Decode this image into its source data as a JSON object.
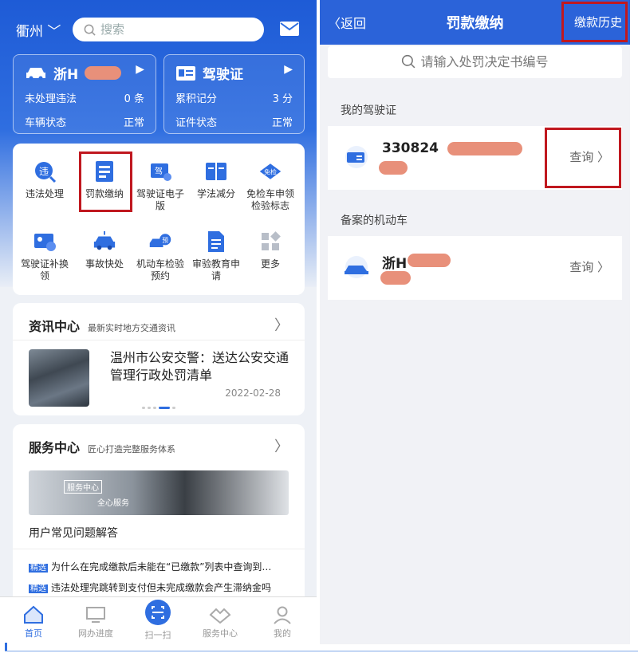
{
  "left": {
    "city": "衢州",
    "search_placeholder": "搜索",
    "vehicle_card": {
      "plate": "浙H",
      "rows": [
        {
          "label": "未处理违法",
          "value": "0",
          "unit": "条"
        },
        {
          "label": "车辆状态",
          "value": "正常"
        }
      ]
    },
    "license_card": {
      "title": "驾驶证",
      "rows": [
        {
          "label": "累积记分",
          "value": "3",
          "unit": "分"
        },
        {
          "label": "证件状态",
          "value": "正常"
        }
      ]
    },
    "services": [
      {
        "label": "违法处理",
        "icon": "violation-icon",
        "badge": "违"
      },
      {
        "label": "罚款缴纳",
        "icon": "fine-payment-icon"
      },
      {
        "label": "驾驶证电子版",
        "icon": "e-license-icon",
        "badge": "驾"
      },
      {
        "label": "学法减分",
        "icon": "book-icon"
      },
      {
        "label": "免检车申领检验标志",
        "icon": "exempt-inspection-icon",
        "badge": "免检"
      },
      {
        "label": "驾驶证补换领",
        "icon": "license-replace-icon"
      },
      {
        "label": "事故快处",
        "icon": "accident-car-icon"
      },
      {
        "label": "机动车检验预约",
        "icon": "inspection-booking-icon",
        "badge": "预"
      },
      {
        "label": "审验教育申请",
        "icon": "document-icon"
      },
      {
        "label": "更多",
        "icon": "more-grid-icon"
      }
    ],
    "news": {
      "title": "资讯中心",
      "subtitle": "最新实时地方交通资讯",
      "headline": "温州市公安交警：送达公安交通管理行政处罚清单",
      "date": "2022-02-28"
    },
    "service_center": {
      "title": "服务中心",
      "subtitle": "匠心打造完整服务体系",
      "banner_tag": "服务中心",
      "banner_text": "全心服务",
      "faq_title": "用户常见问题解答",
      "faq_tag": "精选",
      "faqs": [
        "为什么在完成缴款后未能在“已缴款”列表中查询到…",
        "违法处理完跳转到支付但未完成缴款会产生滞纳金吗"
      ]
    },
    "tabs": [
      {
        "label": "首页",
        "icon": "home-icon"
      },
      {
        "label": "网办进度",
        "icon": "monitor-icon"
      },
      {
        "label": "扫一扫",
        "icon": "scan-icon"
      },
      {
        "label": "服务中心",
        "icon": "handshake-icon"
      },
      {
        "label": "我的",
        "icon": "user-icon"
      }
    ]
  },
  "right": {
    "back": "返回",
    "title": "罚款缴纳",
    "history": "缴款历史",
    "search_placeholder": "请输入处罚决定书编号",
    "license_section": "我的驾驶证",
    "license_number": "330824",
    "vehicle_section": "备案的机动车",
    "vehicle_plate": "浙H",
    "query_label": "查询"
  },
  "colors": {
    "brand_blue": "#2b63d9",
    "highlight_red": "#c0181f",
    "redaction": "#e8907a"
  }
}
